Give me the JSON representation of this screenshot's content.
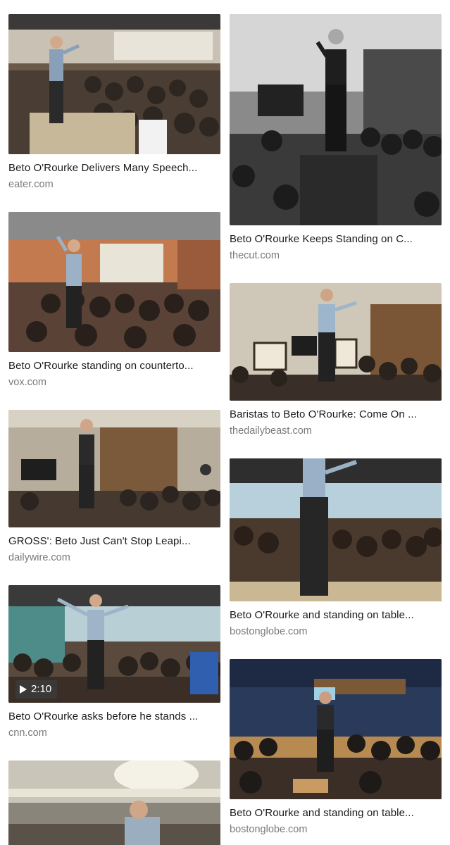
{
  "results": {
    "left": [
      {
        "title": "Beto O'Rourke Delivers Many Speech...",
        "source": "eater.com",
        "tone": "color"
      },
      {
        "title": "Beto O'Rourke standing on counterto...",
        "source": "vox.com",
        "tone": "color"
      },
      {
        "title": "GROSS': Beto Just Can't Stop Leapi...",
        "source": "dailywire.com",
        "tone": "color"
      },
      {
        "title": "Beto O'Rourke asks before he stands ...",
        "source": "cnn.com",
        "tone": "color",
        "video_duration": "2:10"
      },
      {
        "title": "",
        "source": "",
        "tone": "color"
      }
    ],
    "right": [
      {
        "title": "Beto O'Rourke Keeps Standing on C...",
        "source": "thecut.com",
        "tone": "bw"
      },
      {
        "title": "Baristas to Beto O'Rourke: Come On ...",
        "source": "thedailybeast.com",
        "tone": "color"
      },
      {
        "title": "Beto O'Rourke and standing on table...",
        "source": "bostonglobe.com",
        "tone": "color"
      },
      {
        "title": "Beto O'Rourke and standing on table...",
        "source": "bostonglobe.com",
        "tone": "color"
      }
    ]
  }
}
